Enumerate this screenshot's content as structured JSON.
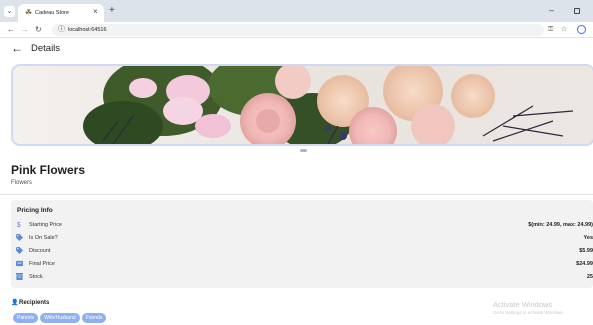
{
  "browser": {
    "tab_title": "Cadeau Store",
    "tab_close": "×",
    "new_tab": "+",
    "url": "localhost:64516",
    "minimize": "–"
  },
  "header": {
    "back_icon": "arrow-left-icon",
    "title": "Details"
  },
  "product": {
    "image_alt": "pink roses and alstroemeria bouquet",
    "name": "Pink Flowers",
    "category": "Flowers"
  },
  "pricing": {
    "title": "Pricing Info",
    "rows": [
      {
        "icon": "dollar-icon",
        "label": "Starting Price",
        "value": "$(min: 24.99, max: 24.99)"
      },
      {
        "icon": "tag-icon",
        "label": "Is On Sale?",
        "value": "Yes"
      },
      {
        "icon": "tag-icon",
        "label": "Discount",
        "value": "$5.99"
      },
      {
        "icon": "receipt-icon",
        "label": "Final Price",
        "value": "$24.99"
      },
      {
        "icon": "warehouse-icon",
        "label": "Stock",
        "value": "25"
      }
    ]
  },
  "recipients": {
    "title": "Recipients",
    "chips": [
      "Parents",
      "Wife/Husband",
      "Friends"
    ]
  },
  "watermark": {
    "title": "Activate Windows",
    "subtitle": "Go to Settings to activate Windows."
  },
  "colors": {
    "accent": "#3b6ee8",
    "chip": "#8fb0f0",
    "card": "#f2f2f2"
  }
}
